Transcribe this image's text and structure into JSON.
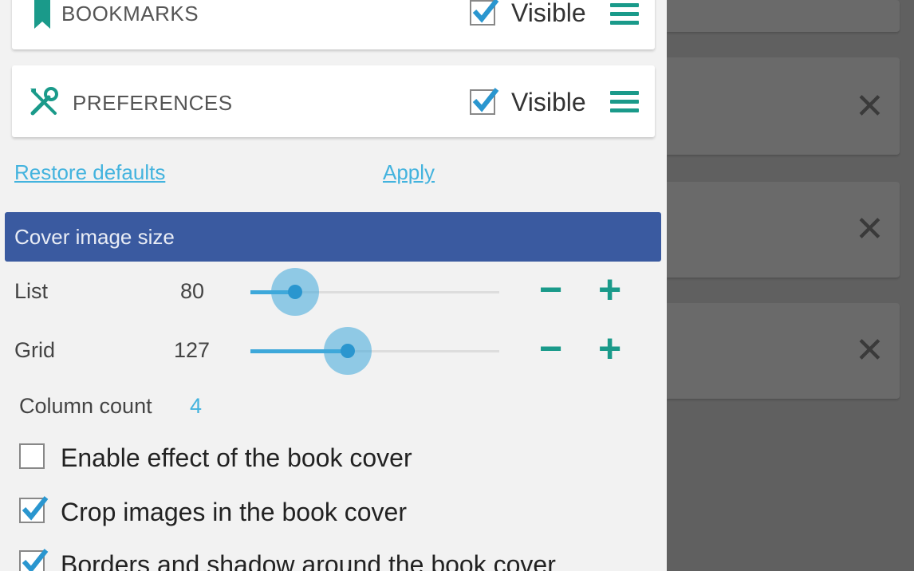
{
  "sections": [
    {
      "name": "bookmarks",
      "title": "BOOKMARKS",
      "visible_label": "Visible",
      "checked": true
    },
    {
      "name": "preferences",
      "title": "PREFERENCES",
      "visible_label": "Visible",
      "checked": true
    }
  ],
  "links": {
    "restore": "Restore defaults",
    "apply": "Apply"
  },
  "cover": {
    "header": "Cover image size",
    "list": {
      "label": "List",
      "value": "80",
      "level": 0.18
    },
    "grid": {
      "label": "Grid",
      "value": "127",
      "level": 0.39
    },
    "column_count_label": "Column count",
    "column_count_value": "4"
  },
  "options": [
    {
      "label": "Enable effect of the book cover",
      "checked": false
    },
    {
      "label": "Crop images in the book cover",
      "checked": true
    },
    {
      "label": "Borders and shadow around the book cover",
      "checked": true
    }
  ],
  "controls": {
    "minus": "−",
    "plus": "+",
    "close": "✕"
  },
  "colors": {
    "accent": "#1a9a8a",
    "header": "#3a5aa0",
    "link": "#43b3de",
    "slider": "#3ea8da"
  }
}
